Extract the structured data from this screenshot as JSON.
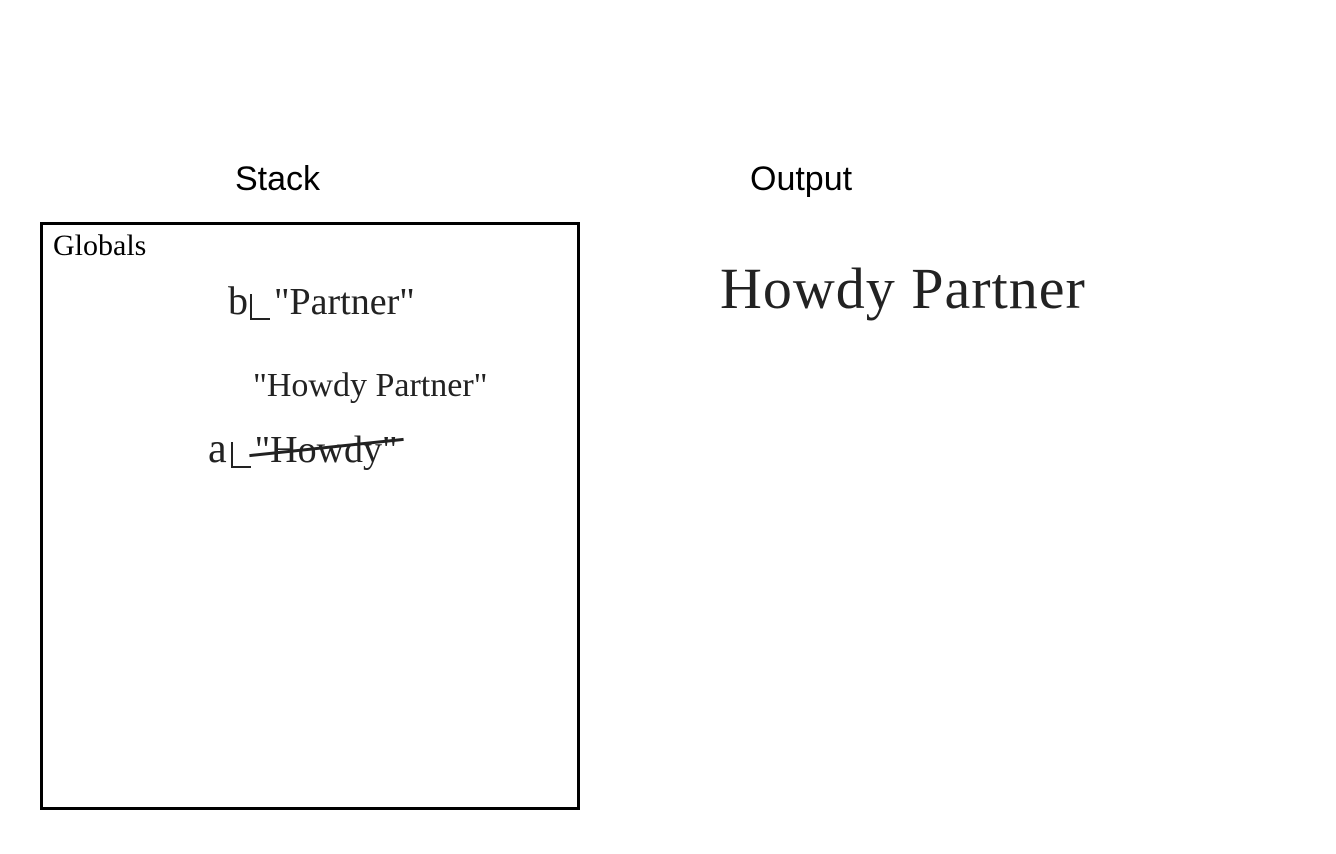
{
  "headings": {
    "stack": "Stack",
    "output": "Output"
  },
  "globals_box": {
    "label": "Globals",
    "variables": {
      "b": {
        "name": "b",
        "value": "\"Partner\""
      },
      "a": {
        "name": "a",
        "old_value": "\"Howdy\"",
        "new_value": "\"Howdy Partner\""
      }
    }
  },
  "output_value": "Howdy Partner"
}
